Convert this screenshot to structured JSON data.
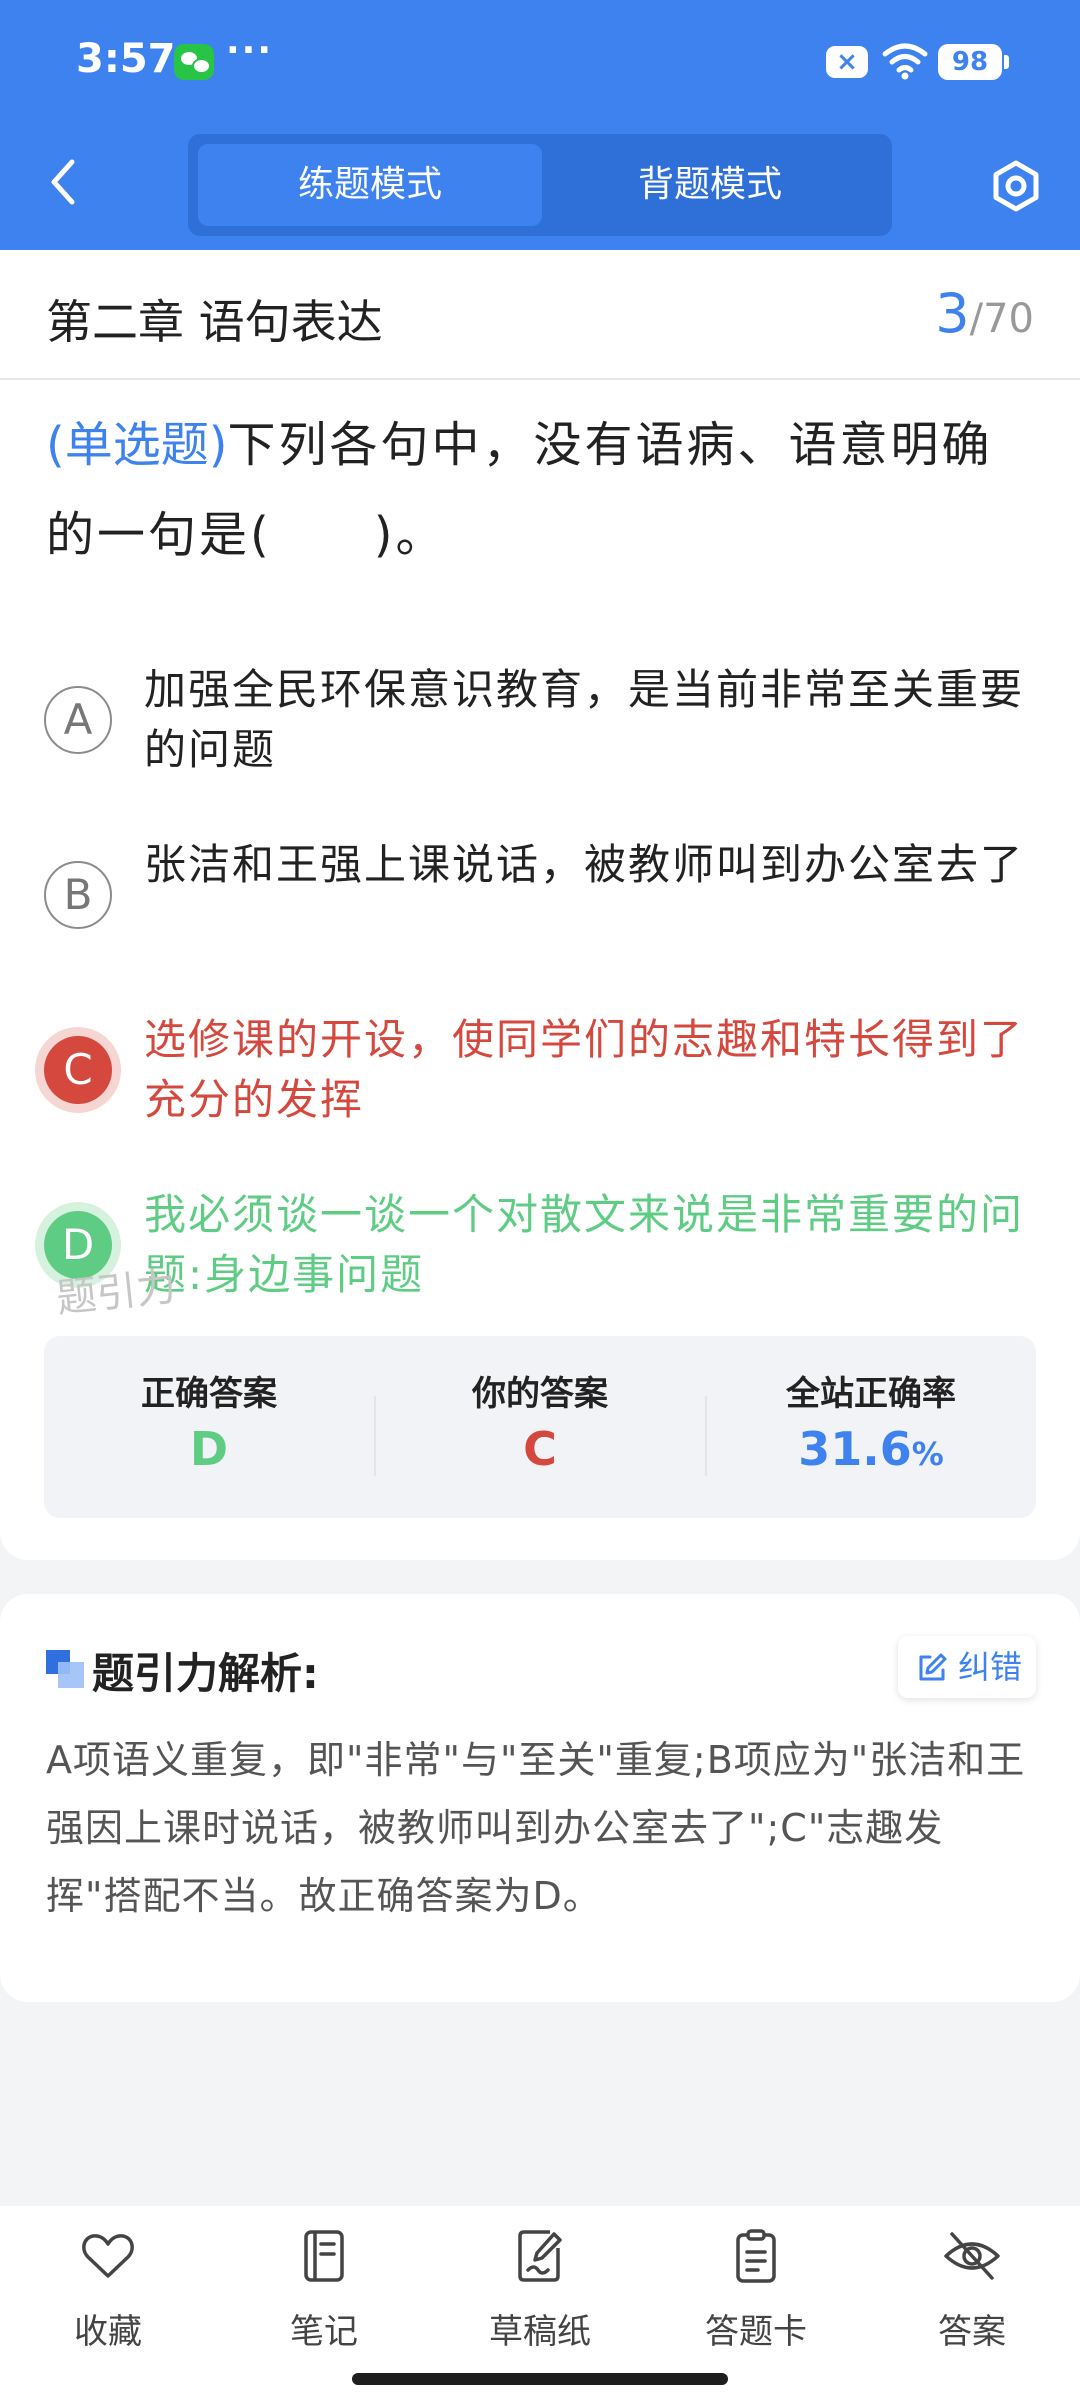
{
  "status_bar": {
    "time": "3:57",
    "dots": "···",
    "battery": "98",
    "x_badge": "×"
  },
  "header": {
    "tabs": [
      {
        "label": "练题模式"
      },
      {
        "label": "背题模式"
      }
    ]
  },
  "question": {
    "chapter": "第二章 语句表达",
    "current": "3",
    "total_sep": "/70",
    "type": "(单选题)",
    "text": "下列各句中，没有语病、语意明确的一句是(　　)。",
    "options": [
      {
        "letter": "A",
        "text": "加强全民环保意识教育，是当前非常至关重要的问题"
      },
      {
        "letter": "B",
        "text": "张洁和王强上课说话，被教师叫到办公室去了"
      },
      {
        "letter": "C",
        "text": "选修课的开设，使同学们的志趣和特长得到了充分的发挥"
      },
      {
        "letter": "D",
        "text": "我必须谈一谈一个对散文来说是非常重要的问题:身边事问题"
      }
    ],
    "watermark": "题引力"
  },
  "stats": {
    "correct_label": "正确答案",
    "correct_value": "D",
    "your_label": "你的答案",
    "your_value": "C",
    "rate_label": "全站正确率",
    "rate_value": "31.6",
    "rate_unit": "%"
  },
  "analysis": {
    "title": "题引力解析:",
    "correct_button": "纠错",
    "text": "A项语义重复，即\"非常\"与\"至关\"重复;B项应为\"张洁和王强因上课时说话，被教师叫到办公室去了\";C\"志趣发挥\"搭配不当。故正确答案为D。"
  },
  "bottom_nav": [
    {
      "label": "收藏",
      "icon": "heart-icon"
    },
    {
      "label": "笔记",
      "icon": "notebook-icon"
    },
    {
      "label": "草稿纸",
      "icon": "draft-paper-icon"
    },
    {
      "label": "答题卡",
      "icon": "answer-sheet-icon"
    },
    {
      "label": "答案",
      "icon": "eye-off-icon"
    }
  ],
  "colors": {
    "primary": "#3d82ee",
    "wrong": "#d4483e",
    "right": "#5fcc84"
  }
}
